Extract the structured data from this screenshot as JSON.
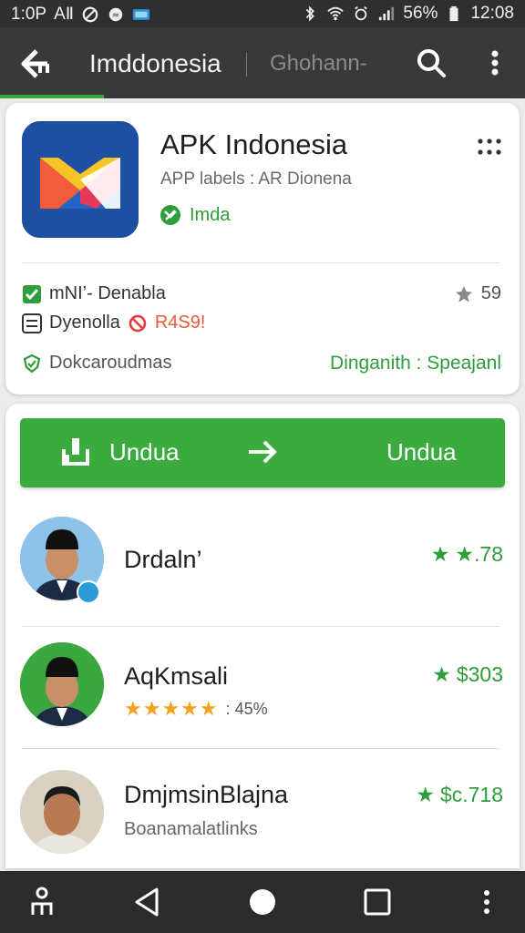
{
  "status_bar": {
    "time_left": "1:0P",
    "label_left": "AⅡ",
    "battery": "56%",
    "time_right": "12:08"
  },
  "app_bar": {
    "title": "Imddonesia",
    "search_text": "Ghohann-"
  },
  "app_card": {
    "name": "APK Indonesia",
    "subtitle": "APP labels : AR Dionena",
    "tag": "Imda",
    "features": [
      {
        "icon": "checkbox-icon",
        "label": "mNI’- Denabla"
      },
      {
        "icon": "list-icon",
        "label": "Dyenolla",
        "warning_label": "R4S9!"
      },
      {
        "icon": "shield-check-icon",
        "label": "Dokcaroudmas"
      }
    ],
    "rating": "59",
    "download_info": "Dinganith  :  Speajanl"
  },
  "download_button": {
    "left_label": "Undua",
    "right_label": "Undua"
  },
  "developers": [
    {
      "name": "Drdaln’",
      "rating": "★.78"
    },
    {
      "name": "AqKmsali",
      "rating": "$303",
      "stars_text": ": 45%"
    },
    {
      "name": "DmjmsinBlajna",
      "rating": "$c.718",
      "subtitle": "Boanamalatlinks"
    }
  ],
  "colors": {
    "accent": "#3bab3f",
    "app_bar": "#393939",
    "status_bar": "#2f2f2f",
    "nav_bar": "#2b2b2b",
    "stars": "#f4a11e"
  }
}
